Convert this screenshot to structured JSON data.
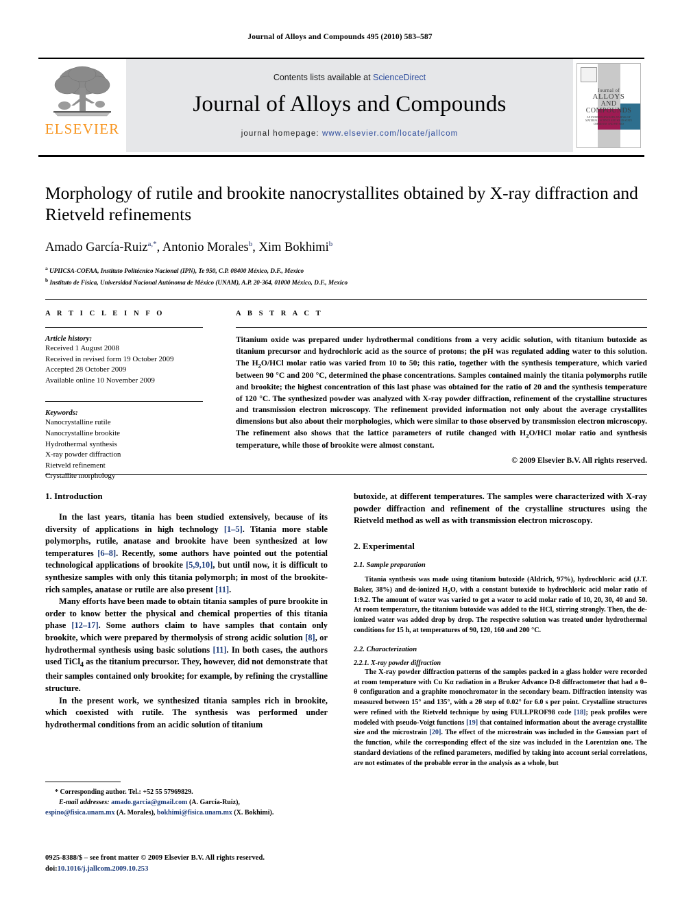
{
  "running_head": "Journal of Alloys and Compounds 495 (2010) 583–587",
  "masthead": {
    "contents_prefix": "Contents lists available at ",
    "sciencedirect": "ScienceDirect",
    "journal_title": "Journal of Alloys and Compounds",
    "homepage_label": "journal homepage:",
    "homepage_url": "www.elsevier.com/locate/jallcom",
    "elsevier_wordmark": "ELSEVIER",
    "elsevier_color": "#f7941e",
    "link_color": "#2b4a9b",
    "band_color": "#e6e7e9",
    "cover": {
      "line1": "Journal of",
      "line2": "ALLOYS",
      "line3": "AND COMPOUNDS",
      "line4": "AN INTERDISCIPLINARY JOURNAL OF MATERIALS SCIENCE AND SOLID-STATE CHEMISTRY AND PHYSICS",
      "magenta": "#9e1b53",
      "teal": "#2e6f8e",
      "gray": "#c9c9c9"
    }
  },
  "article": {
    "title": "Morphology of rutile and brookite nanocrystallites obtained by X-ray diffraction and Rietveld refinements",
    "authors": [
      {
        "name": "Amado García-Ruiz",
        "marks": "a,*"
      },
      {
        "name": "Antonio Morales",
        "marks": "b"
      },
      {
        "name": "Xim Bokhimi",
        "marks": "b"
      }
    ],
    "affiliations": [
      {
        "mark": "a",
        "text": "UPIICSA-COFAA, Instituto Politécnico Nacional (IPN), Te 950, C.P. 08400 México, D.F., Mexico"
      },
      {
        "mark": "b",
        "text": "Instituto de Física, Universidad Nacional Autónoma de México (UNAM), A.P. 20-364, 01000 México, D.F., Mexico"
      }
    ]
  },
  "article_info": {
    "heading": "A R T I C L E    I N F O",
    "history_label": "Article history:",
    "history": [
      "Received 1 August 2008",
      "Received in revised form 19 October 2009",
      "Accepted 28 October 2009",
      "Available online 10 November 2009"
    ],
    "keywords_label": "Keywords:",
    "keywords": [
      "Nanocrystalline rutile",
      "Nanocrystalline brookite",
      "Hydrothermal synthesis",
      "X-ray powder diffraction",
      "Rietveld refinement",
      "Crystallite morphology"
    ]
  },
  "abstract": {
    "heading": "A B S T R A C T",
    "part1": "Titanium oxide was prepared under hydrothermal conditions from a very acidic solution, with titanium butoxide as titanium precursor and hydrochloric acid as the source of protons; the pH was regulated adding water to this solution. The H",
    "sub1": "2",
    "part2": "O/HCl molar ratio was varied from 10 to 50; this ratio, together with the synthesis temperature, which varied between 90 °C and 200 °C, determined the phase concentrations. Samples contained mainly the titania polymorphs rutile and brookite; the highest concentration of this last phase was obtained for the ratio of 20 and the synthesis temperature of 120 °C. The synthesized powder was analyzed with X-ray powder diffraction, refinement of the crystalline structures and transmission electron microscopy. The refinement provided information not only about the average crystallites dimensions but also about their morphologies, which were similar to those observed by transmission electron microscopy. The refinement also shows that the lattice parameters of rutile changed with H",
    "sub2": "2",
    "part3": "O/HCl molar ratio and synthesis temperature, while those of brookite were almost constant.",
    "copyright": "© 2009 Elsevier B.V. All rights reserved."
  },
  "body": {
    "intro_heading": "1.  Introduction",
    "intro_p1_a": "In the last years, titania has been studied extensively, because of its diversity of applications in high technology ",
    "intro_p1_r1": "[1–5]",
    "intro_p1_b": ". Titania more stable polymorphs, rutile, anatase and brookite have been synthesized at low temperatures ",
    "intro_p1_r2": "[6–8]",
    "intro_p1_c": ". Recently, some authors have pointed out the potential technological applications of brookite ",
    "intro_p1_r3": "[5,9,10]",
    "intro_p1_d": ", but until now, it is difficult to synthesize samples with only this titania polymorph; in most of the brookite-rich samples, anatase or rutile are also present ",
    "intro_p1_r4": "[11]",
    "intro_p1_e": ".",
    "intro_p2_a": "Many efforts have been made to obtain titania samples of pure brookite in order to know better the physical and chemical properties of this titania phase ",
    "intro_p2_r1": "[12–17]",
    "intro_p2_b": ". Some authors claim to have samples that contain only brookite, which were prepared by thermolysis of strong acidic solution ",
    "intro_p2_r2": "[8]",
    "intro_p2_c": ", or hydrothermal synthesis using basic solutions ",
    "intro_p2_r3": "[11]",
    "intro_p2_d": ". In both cases, the authors used TiCl",
    "intro_p2_sub": "4",
    "intro_p2_e": " as the titanium precursor. They, however, did not demonstrate that their samples contained only brookite; for example, by refining the crystalline structure.",
    "intro_p3": "In the present work, we synthesized titania samples rich in brookite, which coexisted with rutile. The synthesis was performed under hydrothermal conditions from an acidic solution of titanium",
    "right_p1": "butoxide, at different temperatures. The samples were characterized with X-ray powder diffraction and refinement of the crystalline structures using the Rietveld method as well as with transmission electron microscopy.",
    "exp_heading": "2.  Experimental",
    "sample_prep_heading": "2.1.  Sample preparation",
    "sample_prep_a": "Titania synthesis was made using titanium butoxide (Aldrich, 97%), hydrochloric acid (J.T. Baker, 38%) and de-ionized H",
    "sample_prep_sub": "2",
    "sample_prep_b": "O, with a constant butoxide to hydrochloric acid molar ratio of 1:9.2. The amount of water was varied to get a water to acid molar ratio of 10, 20, 30, 40 and 50. At room temperature, the titanium butoxide was added to the HCl, stirring strongly. Then, the de-ionized water was added drop by drop. The respective solution was treated under hydrothermal conditions for 15 h, at temperatures of 90, 120, 160 and 200 °C.",
    "characterization_heading": "2.2.  Characterization",
    "xrd_heading": "2.2.1.  X-ray powder diffraction",
    "xrd_a": "The X-ray powder diffraction patterns of the samples packed in a glass holder were recorded at room temperature with Cu Kα radiation in a Bruker Advance D-8 diffractometer that had a θ–θ configuration and a graphite monochromator in the secondary beam. Diffraction intensity was measured between 15° and 135°, with a 2θ step of 0.02° for 6.0 s per point. Crystalline structures were refined with the Rietveld technique by using FULLPROF98 code ",
    "xrd_r1": "[18]",
    "xrd_b": "; peak profiles were modeled with pseudo-Voigt functions ",
    "xrd_r2": "[19]",
    "xrd_c": " that contained information about the average crystallite size and the microstrain ",
    "xrd_r3": "[20]",
    "xrd_d": ". The effect of the microstrain was included in the Gaussian part of the function, while the corresponding effect of the size was included in the Lorentzian one. The standard deviations of the refined parameters, modified by taking into account serial correlations, are not estimates of the probable error in the analysis as a whole, but"
  },
  "footnote": {
    "star_line": "* Corresponding author. Tel.: +52 55 57969829.",
    "email_label": "E-mail addresses:",
    "email1": "amado.garcia@gmail.com",
    "email1_owner": " (A. García-Ruiz),",
    "email2": "espino@fisica.unam.mx",
    "email2_owner": " (A. Morales),",
    "email3": "bokhimi@fisica.unam.mx",
    "email3_owner": " (X. Bokhimi)."
  },
  "footer": {
    "issn_line": "0925-8388/$ – see front matter © 2009 Elsevier B.V. All rights reserved.",
    "doi_label": "doi:",
    "doi_value": "10.1016/j.jallcom.2009.10.253"
  }
}
